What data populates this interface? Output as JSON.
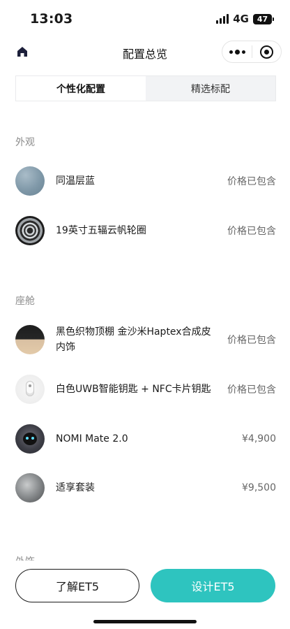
{
  "status_bar": {
    "time": "13:03",
    "network": "4G",
    "battery": "47"
  },
  "nav": {
    "title": "配置总览"
  },
  "tabs": [
    {
      "label": "个性化配置",
      "active": true
    },
    {
      "label": "精选标配",
      "active": false
    }
  ],
  "sections": [
    {
      "label": "外观",
      "items": [
        {
          "name": "同温层蓝",
          "price": "价格已包含"
        },
        {
          "name": "19英寸五辐云帆轮圈",
          "price": "价格已包含"
        }
      ]
    },
    {
      "label": "座舱",
      "items": [
        {
          "name": "黑色织物顶棚 金沙米Haptex合成皮内饰",
          "price": "价格已包含"
        },
        {
          "name": "白色UWB智能钥匙 + NFC卡片钥匙",
          "price": "价格已包含"
        },
        {
          "name": "NOMI Mate 2.0",
          "price": "¥4,900"
        },
        {
          "name": "适享套装",
          "price": "¥9,500"
        }
      ]
    },
    {
      "label": "外饰"
    }
  ],
  "buttons": {
    "learn": "了解ET5",
    "design": "设计ET5"
  },
  "colors": {
    "accent": "#2ec4bf",
    "text": "#1a1a1a",
    "muted": "#8c8c8c"
  }
}
